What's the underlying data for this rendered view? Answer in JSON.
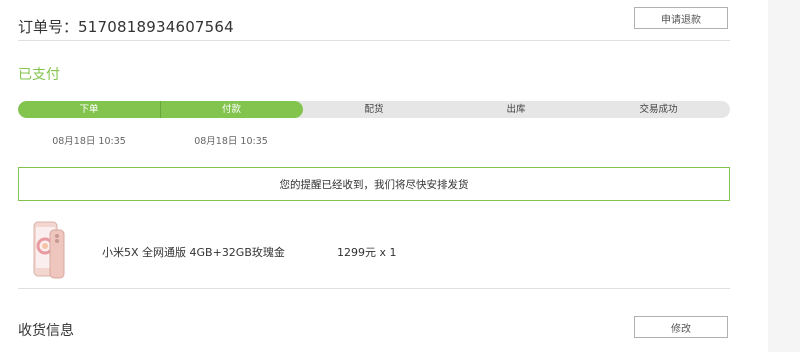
{
  "order": {
    "label": "订单号：",
    "number": "5170818934607564",
    "refund_button": "申请退款"
  },
  "status": {
    "text": "已支付"
  },
  "progress": {
    "steps": [
      {
        "label": "下单",
        "time": "08月18日 10:35",
        "state": "done"
      },
      {
        "label": "付款",
        "time": "08月18日 10:35",
        "state": "done"
      },
      {
        "label": "配货",
        "time": "",
        "state": "todo"
      },
      {
        "label": "出库",
        "time": "",
        "state": "todo"
      },
      {
        "label": "交易成功",
        "time": "",
        "state": "todo"
      }
    ],
    "completed_steps": 2,
    "total_steps": 5
  },
  "notice": {
    "text": "您的提醒已经收到，我们将尽快安排发货"
  },
  "product": {
    "name": "小米5X 全网通版 4GB+32GB玫瑰金",
    "price": "1299元 x 1",
    "image_icon": "phone-image"
  },
  "receiver": {
    "title": "收货信息",
    "modify_button": "修改"
  },
  "colors": {
    "accent": "#83c44e",
    "track": "#e6e6e6",
    "divider": "#e0e0e0"
  }
}
